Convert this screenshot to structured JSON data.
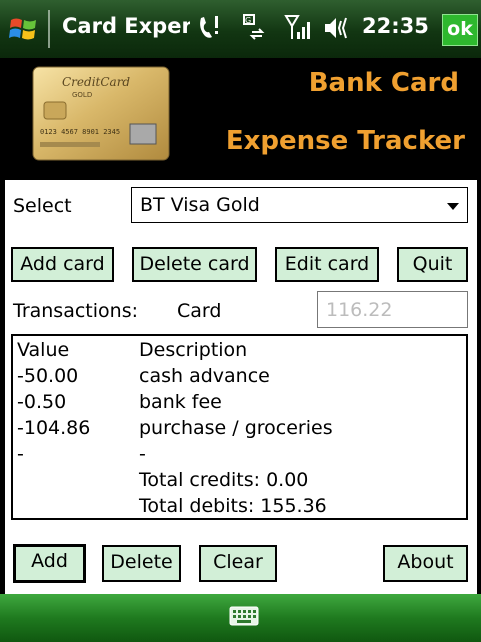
{
  "titlebar": {
    "app_title": "Card Expen",
    "clock": "22:35",
    "ok_label": "ok",
    "icons": [
      "windows-logo-icon",
      "phone-signal-icon",
      "data-connection-icon",
      "antenna-signal-icon",
      "speaker-volume-icon"
    ]
  },
  "banner": {
    "line1": "Bank Card",
    "line2": "Expense Tracker",
    "card_image": {
      "brand": "CreditCard",
      "tier": "GOLD",
      "number_line": "0123 4567 8901 2345",
      "colors": {
        "gold_light": "#f7e3a6",
        "gold_dark": "#b08a3e"
      }
    }
  },
  "form": {
    "select_label": "Select",
    "selected_card": "BT Visa Gold",
    "buttons": {
      "add_card": "Add card",
      "delete_card": "Delete card",
      "edit_card": "Edit card",
      "quit": "Quit",
      "add": "Add",
      "delete": "Delete",
      "clear": "Clear",
      "about": "About"
    },
    "transactions_label": "Transactions:",
    "card_label": "Card",
    "card_value": "116.22",
    "list": {
      "headers": {
        "value": "Value",
        "description": "Description"
      },
      "rows": [
        {
          "value": "-50.00",
          "description": "cash advance"
        },
        {
          "value": "-0.50",
          "description": "bank fee"
        },
        {
          "value": "-104.86",
          "description": "purchase / groceries"
        },
        {
          "value": "-",
          "description": "-"
        }
      ],
      "total_credits": "Total credits: 0.00",
      "total_debits": "Total debits: 155.36"
    }
  },
  "bottom": {
    "keyboard_icon": "keyboard-icon"
  },
  "colors": {
    "accent_orange": "#f0a030",
    "button_bg": "#d2efd7",
    "title_green": "#123612",
    "ok_green": "#2eb82e",
    "bottom_green": "#1f7a1f"
  }
}
